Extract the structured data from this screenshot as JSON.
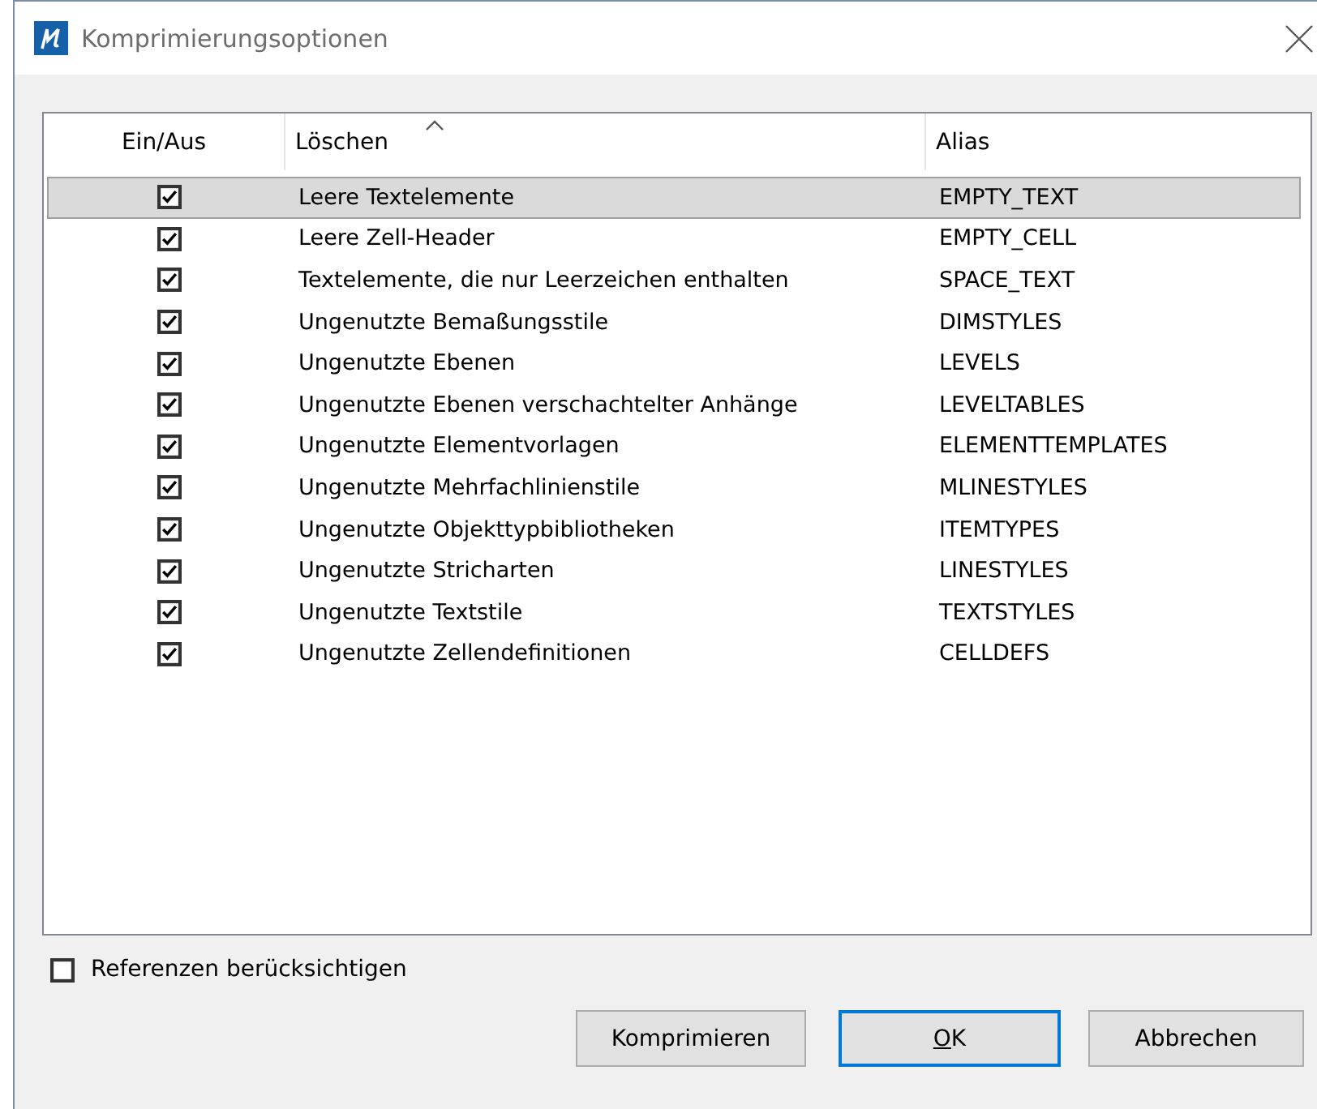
{
  "window": {
    "title": "Komprimierungsoptionen"
  },
  "table": {
    "columns": [
      {
        "label": "Ein/Aus",
        "sorted": false
      },
      {
        "label": "Löschen",
        "sorted": true
      },
      {
        "label": "Alias",
        "sorted": false
      }
    ],
    "rows": [
      {
        "checked": true,
        "selected": true,
        "name": "Leere Textelemente",
        "alias": "EMPTY_TEXT"
      },
      {
        "checked": true,
        "selected": false,
        "name": "Leere Zell-Header",
        "alias": "EMPTY_CELL"
      },
      {
        "checked": true,
        "selected": false,
        "name": "Textelemente, die nur Leerzeichen enthalten",
        "alias": "SPACE_TEXT"
      },
      {
        "checked": true,
        "selected": false,
        "name": "Ungenutzte Bemaßungsstile",
        "alias": "DIMSTYLES"
      },
      {
        "checked": true,
        "selected": false,
        "name": "Ungenutzte Ebenen",
        "alias": "LEVELS"
      },
      {
        "checked": true,
        "selected": false,
        "name": "Ungenutzte Ebenen verschachtelter Anhänge",
        "alias": "LEVELTABLES"
      },
      {
        "checked": true,
        "selected": false,
        "name": "Ungenutzte Elementvorlagen",
        "alias": "ELEMENTTEMPLATES"
      },
      {
        "checked": true,
        "selected": false,
        "name": "Ungenutzte Mehrfachlinienstile",
        "alias": "MLINESTYLES"
      },
      {
        "checked": true,
        "selected": false,
        "name": "Ungenutzte Objekttypbibliotheken",
        "alias": "ITEMTYPES"
      },
      {
        "checked": true,
        "selected": false,
        "name": "Ungenutzte Stricharten",
        "alias": "LINESTYLES"
      },
      {
        "checked": true,
        "selected": false,
        "name": "Ungenutzte Textstile",
        "alias": "TEXTSTYLES"
      },
      {
        "checked": true,
        "selected": false,
        "name": "Ungenutzte Zellendefinitionen",
        "alias": "CELLDEFS"
      }
    ]
  },
  "references": {
    "label": "Referenzen berücksichtigen",
    "checked": false
  },
  "buttons": [
    {
      "label": "Komprimieren",
      "default": false,
      "mnemonic": false
    },
    {
      "label": "OK",
      "default": true,
      "mnemonic": true
    },
    {
      "label": "Abbrechen",
      "default": false,
      "mnemonic": false
    }
  ]
}
